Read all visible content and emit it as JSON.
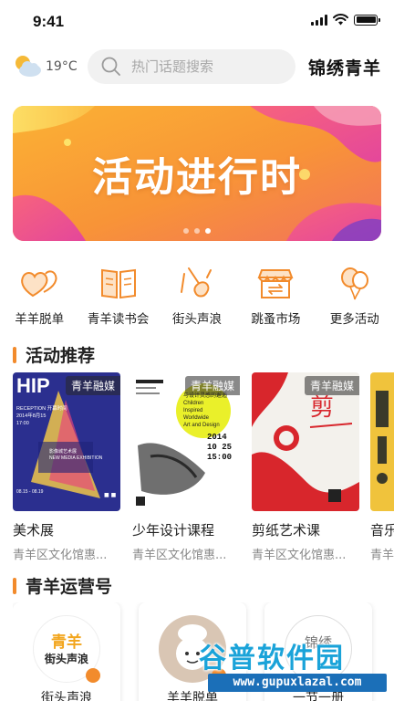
{
  "status_bar": {
    "time": "9:41"
  },
  "header": {
    "weather_icon": "partly-cloudy-icon",
    "temperature": "19°C",
    "search_placeholder": "热门话题搜索",
    "brand": "锦绣青羊"
  },
  "banner": {
    "title": "活动进行时",
    "page_count": 3,
    "active_page": 3
  },
  "quick_nav": [
    {
      "label": "羊羊脱单",
      "icon": "hearts-icon"
    },
    {
      "label": "青羊读书会",
      "icon": "book-icon"
    },
    {
      "label": "街头声浪",
      "icon": "guitar-icon"
    },
    {
      "label": "跳蚤市场",
      "icon": "market-icon"
    },
    {
      "label": "更多活动",
      "icon": "balloons-icon"
    }
  ],
  "activities_section": {
    "title": "活动推荐"
  },
  "activities": [
    {
      "tag": "青羊融媒",
      "title": "美术展",
      "subtitle": "青羊区文化馆惠...",
      "poster_text": "HIP",
      "poster_lines": [
        "RECEPTION 开幕时间",
        "2014年8月15",
        "17:00",
        "影像城艺术展",
        "NEW MEDIA EXHIBITION",
        "08.15 - 08.19"
      ]
    },
    {
      "tag": "青羊融媒",
      "title": "少年设计课程",
      "subtitle": "青羊区文化馆惠...",
      "poster_text": "2014 10 25 15:00",
      "poster_lines": [
        "与设计灵感的邂逅",
        "Children",
        "Inspired",
        "Worldwide",
        "Art and Design"
      ]
    },
    {
      "tag": "青羊融媒",
      "title": "剪纸艺术课",
      "subtitle": "青羊区文化馆惠...",
      "poster_text": "剪"
    },
    {
      "tag": "",
      "title": "音乐",
      "subtitle": "青羊"
    }
  ],
  "operators_section": {
    "title": "青羊运营号"
  },
  "operators": [
    {
      "name": "街头声浪",
      "logo_text": "青羊",
      "logo_sub": "街头声浪"
    },
    {
      "name": "羊羊脱单"
    },
    {
      "name": "一节一册",
      "logo_text": "锦绣"
    }
  ],
  "watermark": {
    "name": "谷普软件园",
    "url": "www.gupuxlazal.com"
  },
  "colors": {
    "accent": "#f28b2c",
    "banner_from": "#f7a531",
    "banner_to": "#f06aa0"
  }
}
